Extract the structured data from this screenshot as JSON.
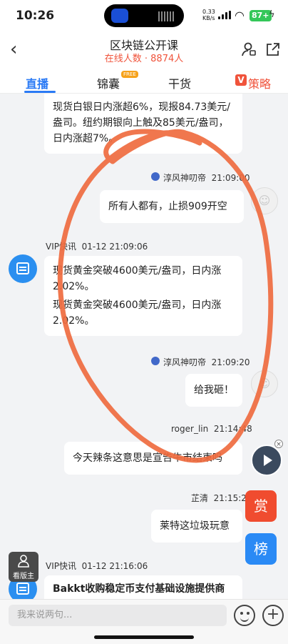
{
  "status_bar": {
    "time": "10:26",
    "net_speed": "0.33",
    "net_unit": "KB/s",
    "battery": "87+"
  },
  "header": {
    "back_icon": "chevron-left-icon",
    "title": "区块链公开课",
    "online_label": "在线人数",
    "online_count": "8874人"
  },
  "tabs": [
    {
      "label": "直播",
      "active": true
    },
    {
      "label": "锦囊",
      "badge": "FREE"
    },
    {
      "label": "干货"
    },
    {
      "label": "策略",
      "icon_text": "V"
    }
  ],
  "messages": {
    "m1_text": "现货白银日内涨超6%，现报84.73美元/盎司。纽约期银向上触及85美元/盎司，日内涨超7%。",
    "m2_user": "淳风神叨帝",
    "m2_time": "21:09:00",
    "m2_text": "所有人都有，止损909开空",
    "m3_user": "VIP快讯",
    "m3_time": "01-12 21:09:06",
    "m3_text1": "现货黄金突破4600美元/盎司，日内涨2.02%。",
    "m3_text2": "现货黄金突破4600美元/盎司，日内涨2.02%。",
    "m4_user": "淳风神叨帝",
    "m4_time": "21:09:20",
    "m4_text": "给我砸！",
    "m5_user": "roger_lin",
    "m5_time": "21:14:48",
    "m5_text": "今天辣条这意思是宣告牛市结束吗",
    "m6_user": "芷清",
    "m6_time": "21:15:26",
    "m6_text": "莱特这垃圾玩意",
    "m7_user": "VIP快讯",
    "m7_time": "01-12 21:16:06",
    "m7_text": "Bakkt收购稳定币支付基础设施提供商"
  },
  "floating": {
    "reward": "赏",
    "rank": "榜",
    "host": "看版主"
  },
  "input": {
    "placeholder": "我来说两句..."
  },
  "colors": {
    "accent_blue": "#2a7af5",
    "accent_red": "#f0533b",
    "annotation_orange": "#ef6b3f"
  }
}
